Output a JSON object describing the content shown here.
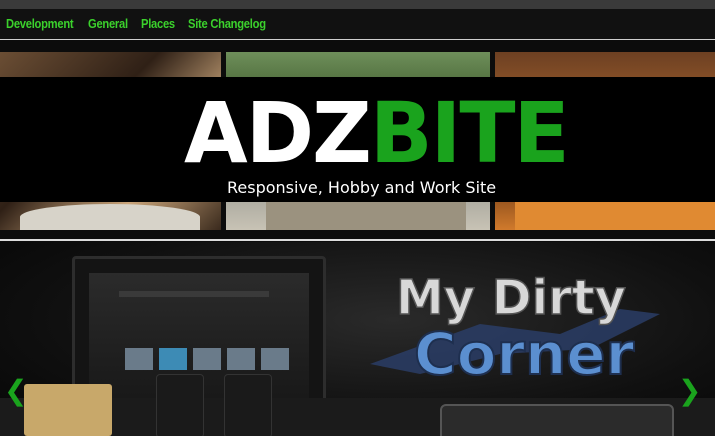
{
  "nav": {
    "items": [
      {
        "label": "Development"
      },
      {
        "label": "General"
      },
      {
        "label": "Places"
      },
      {
        "label": "Site Changelog"
      }
    ]
  },
  "header": {
    "logo_part1": "ADZ",
    "logo_part2": "BITE",
    "tagline": "Responsive, Hobby and Work Site"
  },
  "slider": {
    "slide_title_line1": "My Dirty",
    "slide_title_line2": "Corner",
    "prev_icon": "chevron-left-icon",
    "next_icon": "chevron-right-icon",
    "prev_glyph": "❮",
    "next_glyph": "❯"
  },
  "colors": {
    "accent": "#1aa31d",
    "nav_link": "#3bd12c",
    "slide_title_light": "#d8d8d8",
    "slide_title_blue": "#5b8fd0"
  }
}
